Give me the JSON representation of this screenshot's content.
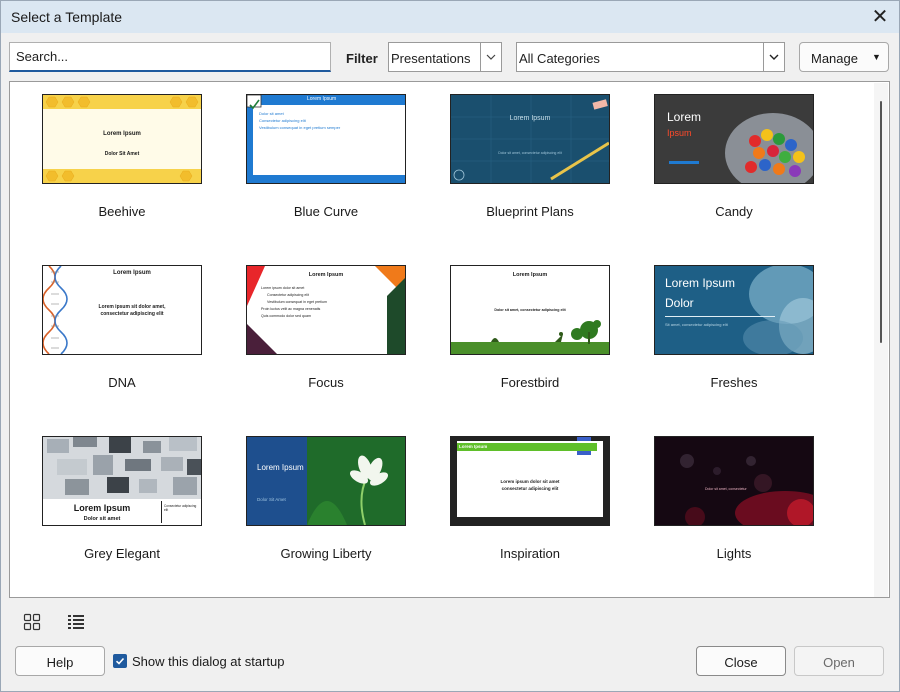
{
  "window": {
    "title": "Select a Template",
    "close_glyph": "✕"
  },
  "search": {
    "placeholder": "Search..."
  },
  "filter": {
    "label": "Filter",
    "type_value": "Presentations",
    "category_value": "All Categories"
  },
  "manage": {
    "label": "Manage",
    "arrow": "▼"
  },
  "templates": [
    {
      "name": "Beehive",
      "line1": "Lorem Ipsum",
      "line2": "Dolor Sit Amet"
    },
    {
      "name": "Blue Curve",
      "line1": "Lorem Ipsum",
      "line2": "Dolor sit amet",
      "line3": "Consectetur adipiscing elit",
      "line4": "Vestibulum consequat in eget pretium semper"
    },
    {
      "name": "Blueprint Plans",
      "line1": "Lorem Ipsum",
      "line2": "Dolor sit amet, consectetur adipiscing elit"
    },
    {
      "name": "Candy",
      "line1": "Lorem",
      "line2": "Ipsum"
    },
    {
      "name": "DNA",
      "line1": "Lorem Ipsum",
      "line2": "Lorem ipsum sit dolor amet,",
      "line3": "consectetur adipiscing elit"
    },
    {
      "name": "Focus",
      "line1": "Lorem Ipsum",
      "line2": "Lorem ipsum dolor sit amet",
      "line3": "Consectetur adipiscing elit",
      "line4": "Vestibulum consequat in eget pretium",
      "line5": "Proin luctus velit ac magna venenatis",
      "line6": "Quis commodo dolor sed quam"
    },
    {
      "name": "Forestbird",
      "line1": "Lorem Ipsum",
      "line2": "Dolor sit amet, consectetur adipiscing elit"
    },
    {
      "name": "Freshes",
      "line1": "Lorem Ipsum",
      "line2": "Dolor",
      "line3": "Sit amet, consectetur adipiscing elit"
    },
    {
      "name": "Grey Elegant",
      "line1": "Lorem Ipsum",
      "line2": "Dolor sit amet",
      "line3": "Consectetur adipiscing elit"
    },
    {
      "name": "Growing Liberty",
      "line1": "Lorem Ipsum",
      "line2": "Dolor Sit Amet"
    },
    {
      "name": "Inspiration",
      "line1": "Lorem Ipsum",
      "line2": "Lorem ipsum dolor sit amet",
      "line3": "consectetur adipiscing elit"
    },
    {
      "name": "Lights",
      "line1": "Lorem Ipsum",
      "line2": "Dolor sit amet, consectetur"
    }
  ],
  "footer": {
    "help_label": "Help",
    "show_at_startup_label": "Show this dialog at startup",
    "show_at_startup_checked": true,
    "close_label": "Close",
    "open_label": "Open"
  },
  "colors": {
    "accent": "#1f5a9e",
    "titlebar": "#dbe7f2",
    "dialog_bg": "#f0f0f0"
  },
  "icons": {
    "thumbnail_view": "grid-view-icon",
    "list_view": "list-view-icon",
    "close": "close-icon"
  }
}
